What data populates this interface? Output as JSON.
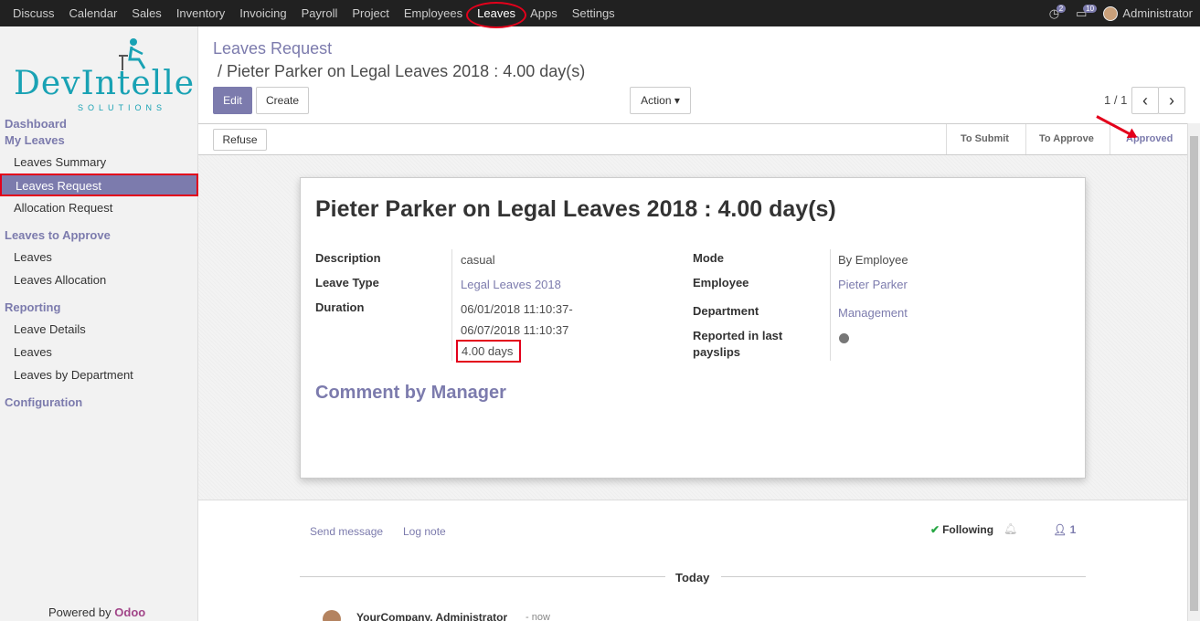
{
  "topbar": {
    "menu": [
      "Discuss",
      "Calendar",
      "Sales",
      "Inventory",
      "Invoicing",
      "Payroll",
      "Project",
      "Employees",
      "Leaves",
      "Apps",
      "Settings"
    ],
    "activity_count": "2",
    "messages_count": "10",
    "user": "Administrator"
  },
  "sidebar": {
    "logo_main": "DevIntelle",
    "logo_sub": "SOLUTIONS",
    "dashboard": "Dashboard",
    "my_leaves": "My Leaves",
    "leaves_summary": "Leaves Summary",
    "leaves_request": "Leaves Request",
    "allocation_request": "Allocation Request",
    "leaves_to_approve": "Leaves to Approve",
    "leaves": "Leaves",
    "leaves_allocation": "Leaves Allocation",
    "reporting": "Reporting",
    "leave_details": "Leave Details",
    "leaves2": "Leaves",
    "leaves_by_department": "Leaves by Department",
    "configuration": "Configuration",
    "powered_by": "Powered by",
    "powered_brand": "Odoo"
  },
  "header": {
    "breadcrumb_parent": "Leaves Request",
    "breadcrumb_current": "/  Pieter Parker on Legal Leaves 2018 : 4.00 day(s)",
    "edit": "Edit",
    "create": "Create",
    "action": "Action ▾",
    "pager": "1 / 1",
    "prev": "‹",
    "next": "›"
  },
  "status": {
    "refuse": "Refuse",
    "stages": [
      "To Submit",
      "To Approve",
      "Approved"
    ],
    "current": "Approved"
  },
  "form": {
    "title": "Pieter Parker on Legal Leaves 2018 : 4.00 day(s)",
    "description_label": "Description",
    "description": "casual",
    "leave_type_label": "Leave Type",
    "leave_type": "Legal Leaves 2018",
    "duration_label": "Duration",
    "date_from": "06/01/2018 11:10:37-",
    "date_to": "06/07/2018 11:10:37",
    "days": "4.00 days",
    "mode_label": "Mode",
    "mode": "By Employee",
    "employee_label": "Employee",
    "employee": "Pieter Parker",
    "department_label": "Department",
    "department": "Management",
    "payslip_label_1": "Reported in last",
    "payslip_label_2": "payslips",
    "comment_heading": "Comment by Manager"
  },
  "chatter": {
    "send_message": "Send message",
    "log_note": "Log note",
    "following": "Following",
    "followers": "1",
    "today": "Today",
    "author": "YourCompany, Administrator",
    "time": "- now"
  },
  "colors": {
    "accent": "#7c7bad",
    "highlight": "#e3001b",
    "topbar": "#212121"
  }
}
